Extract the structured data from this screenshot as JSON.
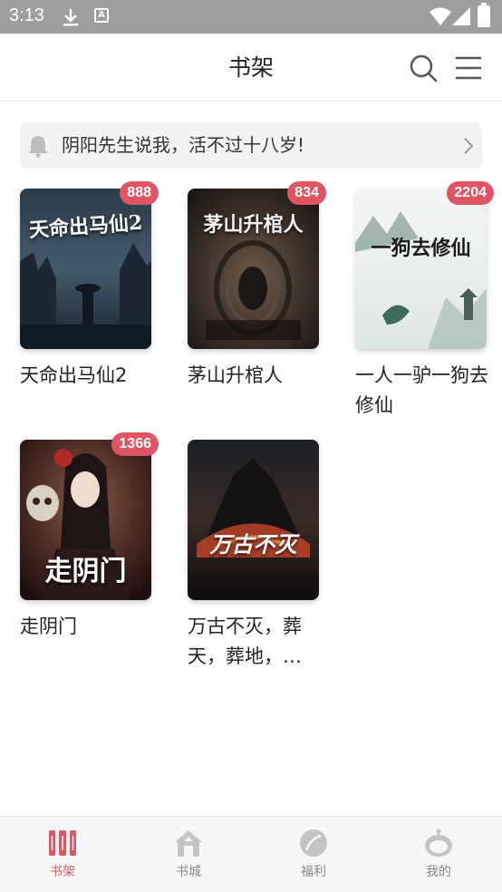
{
  "status_bar": {
    "time": "3:13"
  },
  "header": {
    "title": "书架"
  },
  "notice": {
    "text": "阴阳先生说我，活不过十八岁!"
  },
  "books": [
    {
      "title": "天命出马仙2",
      "badge": "888",
      "cover_text": "天命出马仙2"
    },
    {
      "title": "茅山升棺人",
      "badge": "834",
      "cover_text": "茅山升棺人"
    },
    {
      "title": "一人一驴一狗去修仙",
      "badge": "2204",
      "cover_text": "一狗去修仙"
    },
    {
      "title": "走阴门",
      "badge": "1366",
      "cover_text": "走阴门"
    },
    {
      "title": "万古不灭，葬天，葬地，…",
      "badge": "",
      "cover_text": "万古不灭"
    }
  ],
  "bottom_nav": [
    {
      "label": "书架",
      "icon": "bookshelf-icon",
      "active": true
    },
    {
      "label": "书城",
      "icon": "bookstore-icon",
      "active": false
    },
    {
      "label": "福利",
      "icon": "welfare-icon",
      "active": false
    },
    {
      "label": "我的",
      "icon": "profile-icon",
      "active": false
    }
  ],
  "colors": {
    "accent": "#e05563",
    "inactive": "#b8b8b8",
    "status_bar": "#9e9e9e"
  }
}
